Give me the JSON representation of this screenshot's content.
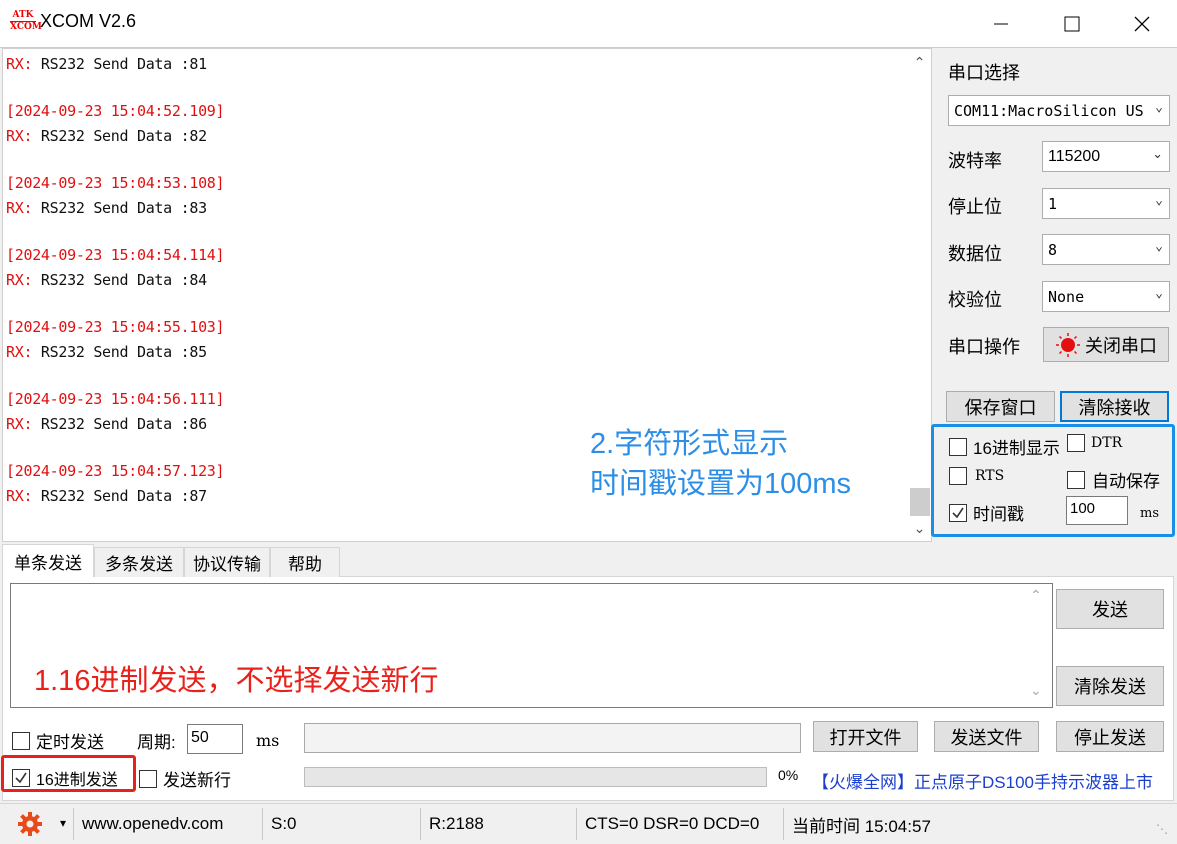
{
  "window": {
    "logo_top": "ATK",
    "logo_bottom": "XCOM",
    "title": "XCOM V2.6"
  },
  "receive": {
    "lines": [
      {
        "timestamp": "",
        "rx": "RX:",
        "text": " RS232 Send Data :81"
      },
      {
        "timestamp": "[2024-09-23 15:04:52.109]",
        "rx": "RX:",
        "text": " RS232 Send Data :82"
      },
      {
        "timestamp": "[2024-09-23 15:04:53.108]",
        "rx": "RX:",
        "text": " RS232 Send Data :83"
      },
      {
        "timestamp": "[2024-09-23 15:04:54.114]",
        "rx": "RX:",
        "text": " RS232 Send Data :84"
      },
      {
        "timestamp": "[2024-09-23 15:04:55.103]",
        "rx": "RX:",
        "text": " RS232 Send Data :85"
      },
      {
        "timestamp": "[2024-09-23 15:04:56.111]",
        "rx": "RX:",
        "text": " RS232 Send Data :86"
      },
      {
        "timestamp": "[2024-09-23 15:04:57.123]",
        "rx": "RX:",
        "text": " RS232 Send Data :87"
      }
    ]
  },
  "annotations": {
    "note2_line1": "2.字符形式显示",
    "note2_line2": "时间戳设置为100ms",
    "note1": "1.16进制发送，不选择发送新行",
    "accent_blue": "#1a8fe6",
    "accent_red": "#e8221b"
  },
  "serial": {
    "port_label": "串口选择",
    "port_value": "COM11:MacroSilicon US",
    "baud_label": "波特率",
    "baud_value": "115200",
    "stop_label": "停止位",
    "stop_value": "1",
    "data_label": "数据位",
    "data_value": "8",
    "parity_label": "校验位",
    "parity_value": "None",
    "op_label": "串口操作",
    "close_port": "关闭串口",
    "save_window": "保存窗口",
    "clear_receive": "清除接收"
  },
  "options": {
    "hex_display": {
      "label": "16进制显示",
      "checked": false
    },
    "dtr": {
      "label": "DTR",
      "checked": false
    },
    "rts": {
      "label": "RTS",
      "checked": false
    },
    "auto_save": {
      "label": "自动保存",
      "checked": false
    },
    "timestamp": {
      "label": "时间戳",
      "checked": true
    },
    "timestamp_value": "100",
    "timestamp_unit": "ms"
  },
  "tabs": [
    {
      "label": "单条发送",
      "active": true
    },
    {
      "label": "多条发送",
      "active": false
    },
    {
      "label": "协议传输",
      "active": false
    },
    {
      "label": "帮助",
      "active": false
    }
  ],
  "send": {
    "send_button": "发送",
    "clear_send": "清除发送",
    "timed_send": {
      "label": "定时发送",
      "checked": false
    },
    "period_label": "周期:",
    "period_value": "50",
    "period_unit": "ms",
    "open_file": "打开文件",
    "send_file": "发送文件",
    "stop_send": "停止发送",
    "hex_send": {
      "label": "16进制发送",
      "checked": true
    },
    "send_newline": {
      "label": "发送新行",
      "checked": false
    },
    "progress_percent": 0,
    "progress_text": "0%",
    "ad_text": "【火爆全网】正点原子DS100手持示波器上市"
  },
  "status": {
    "website": "www.openedv.com",
    "sent": "S:0",
    "received": "R:2188",
    "lines_state": "CTS=0 DSR=0 DCD=0",
    "current_time": "当前时间 15:04:57"
  }
}
